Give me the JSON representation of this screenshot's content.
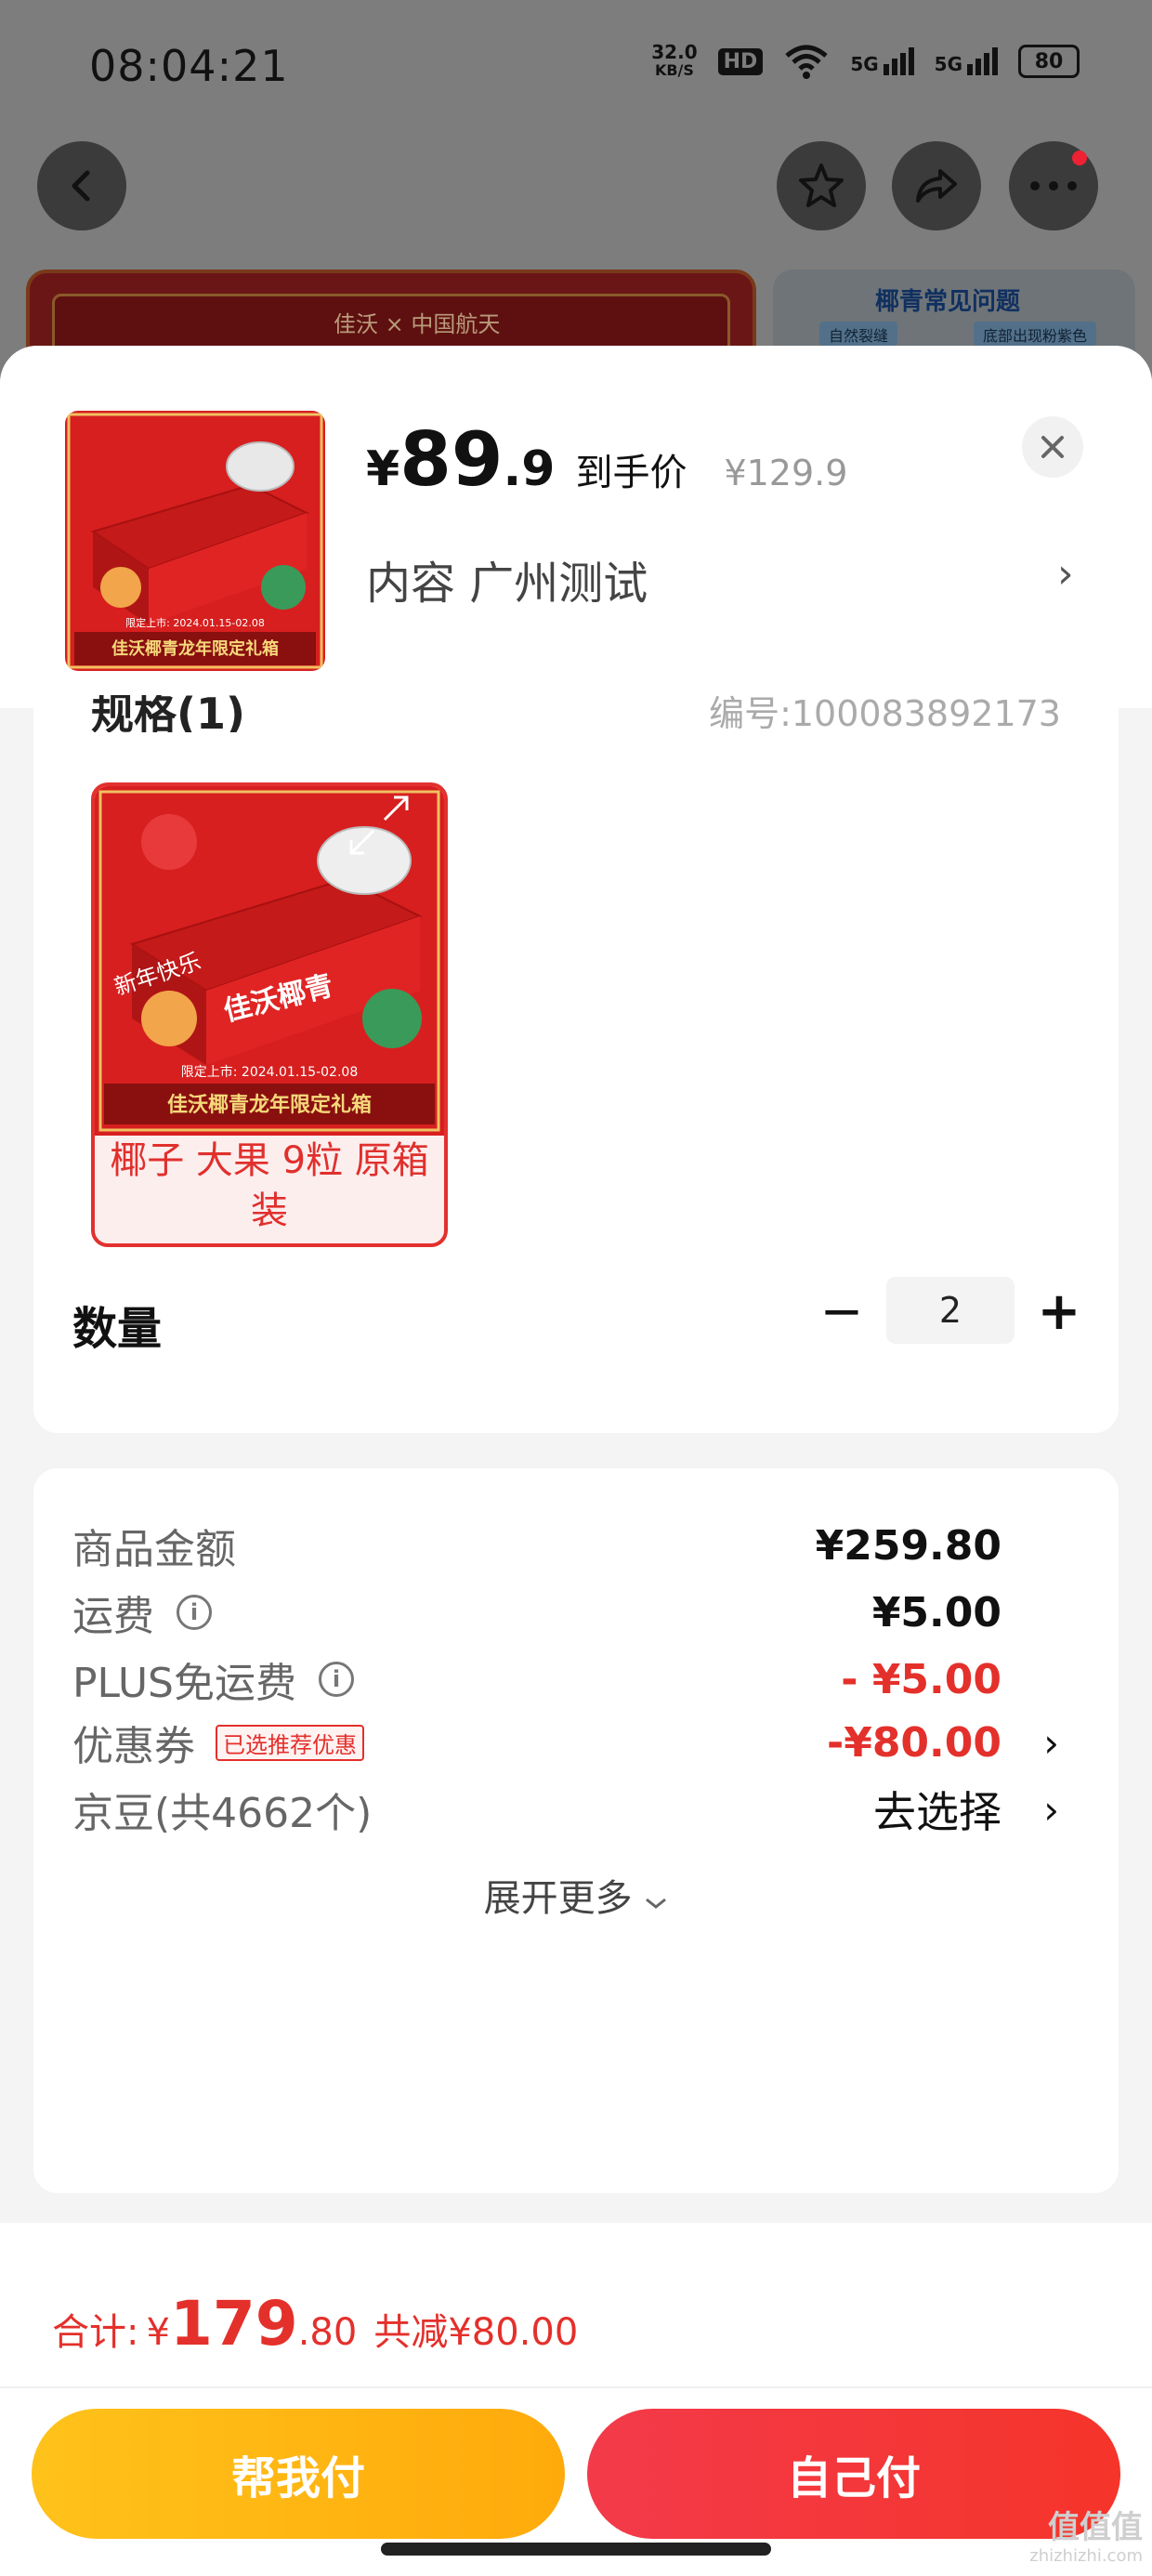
{
  "status_bar": {
    "time": "08:04:21",
    "speed_value": "32.0",
    "speed_unit": "KB/S",
    "hd": "HD",
    "net1": "5G",
    "net2": "5G",
    "battery": "80"
  },
  "background": {
    "banner_left_brand": "佳沃 × 中国航天",
    "banner_right_title": "椰青常见问题",
    "banner_right_tag1": "自然裂缝",
    "banner_right_tag2": "底部出现粉紫色"
  },
  "product": {
    "price_yen": "¥",
    "price_int": "89",
    "price_dec": ".9",
    "price_label": "到手价",
    "original_price": "¥129.9",
    "spec_line": "内容  广州测试",
    "spec_title": "规格(1)",
    "spec_code": "编号:100083892173",
    "spec_option": "椰子 大果 9粒 原箱装",
    "image_caption": "佳沃椰青龙年限定礼箱",
    "image_date": "限定上市: 2024.01.15-02.08",
    "image_box_text": "佳沃椰青",
    "image_greeting": "新年快乐"
  },
  "quantity": {
    "label": "数量",
    "value": "2",
    "minus": "−",
    "plus": "+"
  },
  "fees": {
    "goods_label": "商品金额",
    "goods_value": "¥259.80",
    "shipping_label": "运费",
    "shipping_value": "¥5.00",
    "plus_label": "PLUS免运费",
    "plus_value": "- ¥5.00",
    "coupon_label": "优惠券",
    "coupon_tag": "已选推荐优惠",
    "coupon_value": "-¥80.00",
    "jd_bean_label": "京豆(共4662个)",
    "jd_bean_value": "去选择",
    "expand_more": "展开更多"
  },
  "footer": {
    "total_label": "合计:",
    "total_yen": "¥",
    "total_int": "179",
    "total_dec": ".80",
    "total_save": "共减¥80.00",
    "help_pay": "帮我付",
    "self_pay": "自己付"
  },
  "watermark": {
    "main": "值值值",
    "sub": "zhizhizhi.com"
  },
  "colors": {
    "accent_red": "#e4302b",
    "help_yellow": "#ffb912",
    "pay_red": "#f33a3a"
  },
  "icons": [
    "back-icon",
    "star-icon",
    "share-icon",
    "more-icon",
    "close-icon",
    "chevron-right-icon",
    "info-icon",
    "expand-icon",
    "chevron-down-icon"
  ]
}
